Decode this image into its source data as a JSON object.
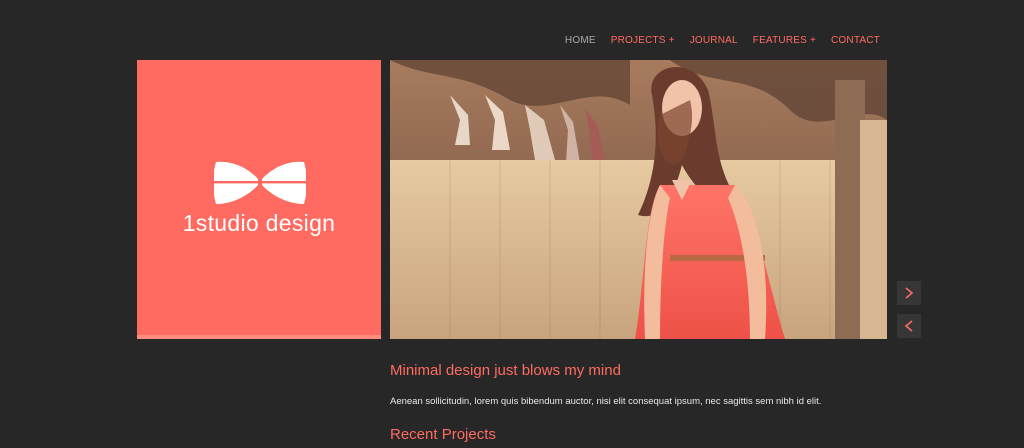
{
  "nav": {
    "items": [
      {
        "label": "HOME",
        "active": true
      },
      {
        "label": "PROJECTS +",
        "active": false
      },
      {
        "label": "JOURNAL",
        "active": false
      },
      {
        "label": "FEATURES +",
        "active": false
      },
      {
        "label": "CONTACT",
        "active": false
      }
    ]
  },
  "logo": {
    "text": "1studio design",
    "icon": "bow-tie-icon",
    "bg_color": "#ff6b61"
  },
  "slider": {
    "image": "woman-in-coral-dress-by-fence",
    "next_icon": "chevron-right-icon",
    "prev_icon": "chevron-left-icon"
  },
  "content": {
    "headline": "Minimal design just blows my mind",
    "paragraph": "Aenean sollicitudin, lorem quis bibendum auctor, nisi elit consequat ipsum, nec sagittis sem nibh id elit.",
    "section_title": "Recent Projects"
  },
  "colors": {
    "accent": "#ff6b61",
    "background": "#272727",
    "button_bg": "#363636"
  }
}
